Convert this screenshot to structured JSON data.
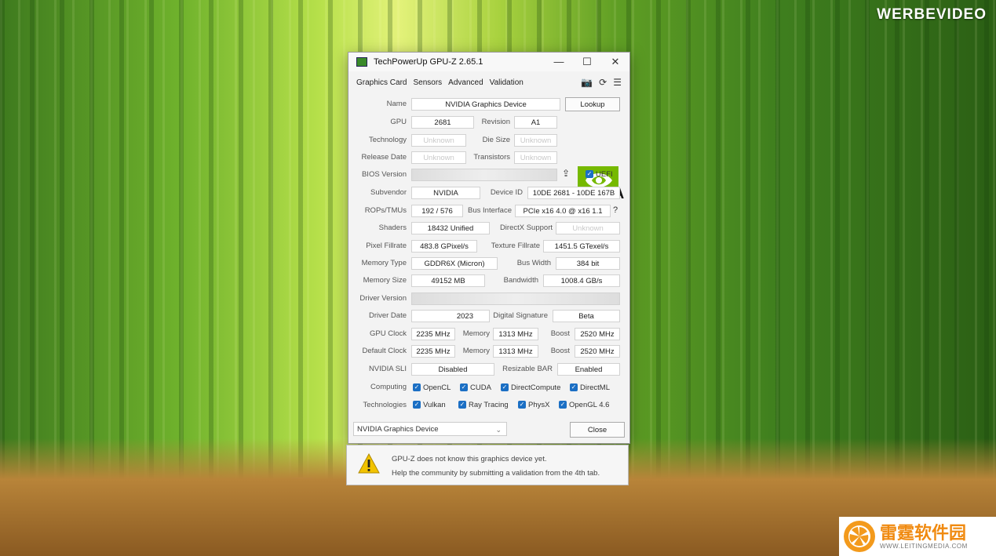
{
  "watermark": "WERBEVIDEO",
  "brand": {
    "cn": "雷霆软件园",
    "url": "WWW.LEITINGMEDIA.COM"
  },
  "window": {
    "title": "TechPowerUp GPU-Z 2.65.1",
    "controls": [
      "—",
      "☐",
      "✕"
    ]
  },
  "menu": [
    "Graphics Card",
    "Sensors",
    "Advanced",
    "Validation"
  ],
  "toolbar_icons": [
    "camera-icon",
    "refresh-icon",
    "menu-icon"
  ],
  "fields": {
    "name": {
      "label": "Name",
      "value": "NVIDIA Graphics Device"
    },
    "lookup": "Lookup",
    "gpu": {
      "label": "GPU",
      "value": "2681"
    },
    "revision": {
      "label": "Revision",
      "value": "A1"
    },
    "technology": {
      "label": "Technology",
      "value": "Unknown"
    },
    "die_size": {
      "label": "Die Size",
      "value": "Unknown"
    },
    "release_date": {
      "label": "Release Date",
      "value": "Unknown"
    },
    "transistors": {
      "label": "Transistors",
      "value": "Unknown"
    },
    "bios_version": {
      "label": "BIOS Version",
      "value": ""
    },
    "uefi": "UEFI",
    "subvendor": {
      "label": "Subvendor",
      "value": "NVIDIA"
    },
    "device_id": {
      "label": "Device ID",
      "value": "10DE 2681 - 10DE 167B"
    },
    "rops": {
      "label": "ROPs/TMUs",
      "value": "192 / 576"
    },
    "bus_interface": {
      "label": "Bus Interface",
      "value": "PCIe x16 4.0 @ x16 1.1"
    },
    "shaders": {
      "label": "Shaders",
      "value": "18432 Unified"
    },
    "directx": {
      "label": "DirectX Support",
      "value": "Unknown"
    },
    "pixel_fillrate": {
      "label": "Pixel Fillrate",
      "value": "483.8 GPixel/s"
    },
    "texture_fillrate": {
      "label": "Texture Fillrate",
      "value": "1451.5 GTexel/s"
    },
    "memory_type": {
      "label": "Memory Type",
      "value": "GDDR6X (Micron)"
    },
    "bus_width": {
      "label": "Bus Width",
      "value": "384 bit"
    },
    "memory_size": {
      "label": "Memory Size",
      "value": "49152 MB"
    },
    "bandwidth": {
      "label": "Bandwidth",
      "value": "1008.4 GB/s"
    },
    "driver_version": {
      "label": "Driver Version",
      "value": ""
    },
    "driver_date": {
      "label": "Driver Date",
      "value": "2023"
    },
    "digital_signature": {
      "label": "Digital Signature",
      "value": "Beta"
    },
    "gpu_clock": {
      "label": "GPU Clock",
      "value": "2235 MHz",
      "mem_label": "Memory",
      "mem": "1313 MHz",
      "boost_label": "Boost",
      "boost": "2520 MHz"
    },
    "default_clock": {
      "label": "Default Clock",
      "value": "2235 MHz",
      "mem_label": "Memory",
      "mem": "1313 MHz",
      "boost_label": "Boost",
      "boost": "2520 MHz"
    },
    "sli": {
      "label": "NVIDIA SLI",
      "value": "Disabled"
    },
    "resizable_bar": {
      "label": "Resizable BAR",
      "value": "Enabled"
    },
    "computing": {
      "label": "Computing",
      "items": [
        "OpenCL",
        "CUDA",
        "DirectCompute",
        "DirectML"
      ]
    },
    "technologies": {
      "label": "Technologies",
      "items": [
        "Vulkan",
        "Ray Tracing",
        "PhysX",
        "OpenGL 4.6"
      ]
    }
  },
  "nvidia_logo_text": "NVIDIA",
  "device_select": "NVIDIA Graphics Device",
  "close": "Close",
  "notice": {
    "line1": "GPU-Z does not know this graphics device yet.",
    "line2": "Help the community by submitting a validation from the 4th tab."
  },
  "colors": {
    "checkbox": "#1b6fc4",
    "nvidia_green": "#76b900",
    "warning": "#f2c300"
  }
}
